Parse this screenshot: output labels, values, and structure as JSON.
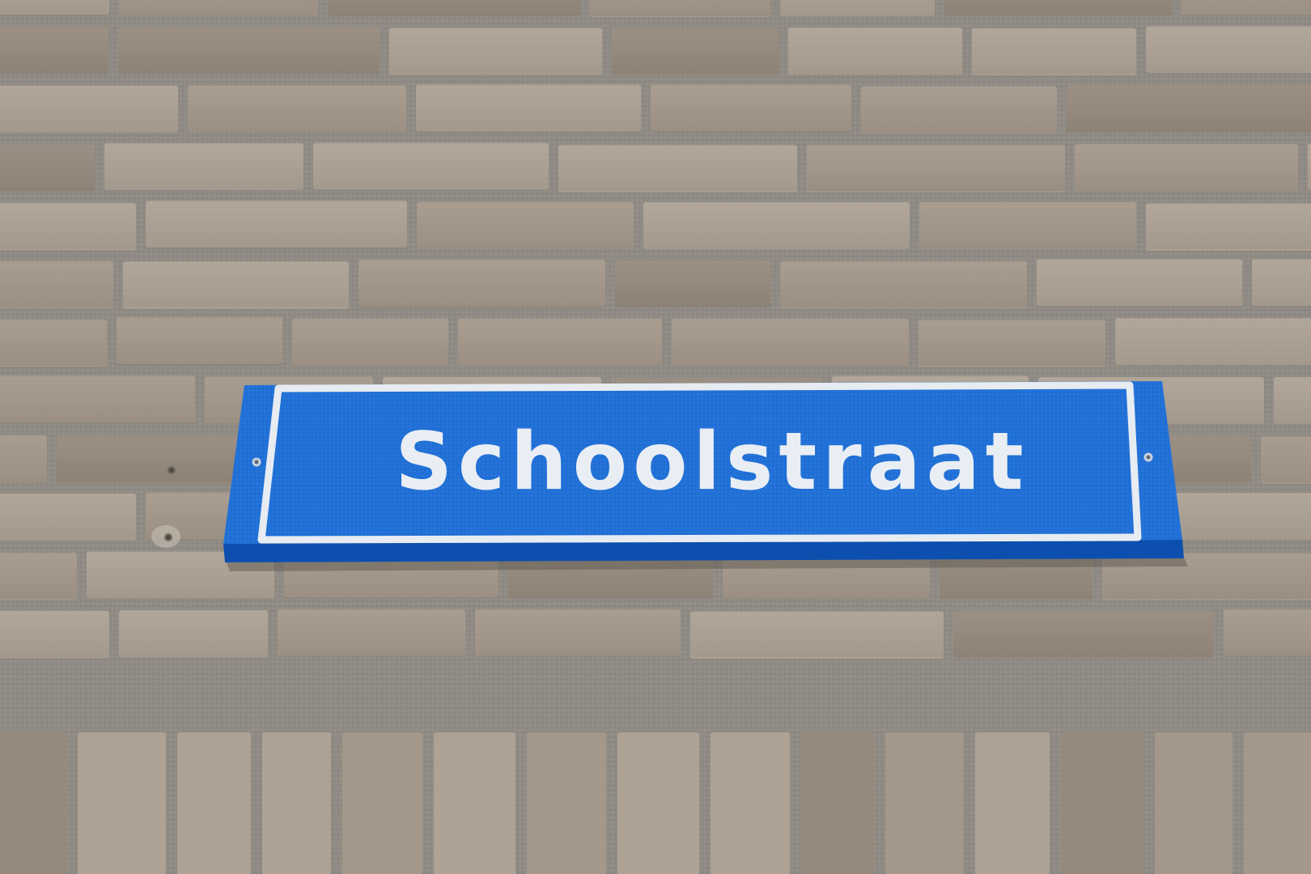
{
  "sign": {
    "text": "Schoolstraat",
    "colors": {
      "panel": "#1f6fd6",
      "panel_edge": "#0d4fae",
      "border": "#e7ecf2",
      "text": "#e9eef4"
    }
  },
  "wall": {
    "colors": {
      "brick": "#a4988a",
      "brick_light": "#ada294",
      "brick_dark": "#968a7d",
      "mortar": "#8f8b84"
    },
    "icons": [
      "screw-hole-icon",
      "mounting-screw-icon"
    ]
  }
}
